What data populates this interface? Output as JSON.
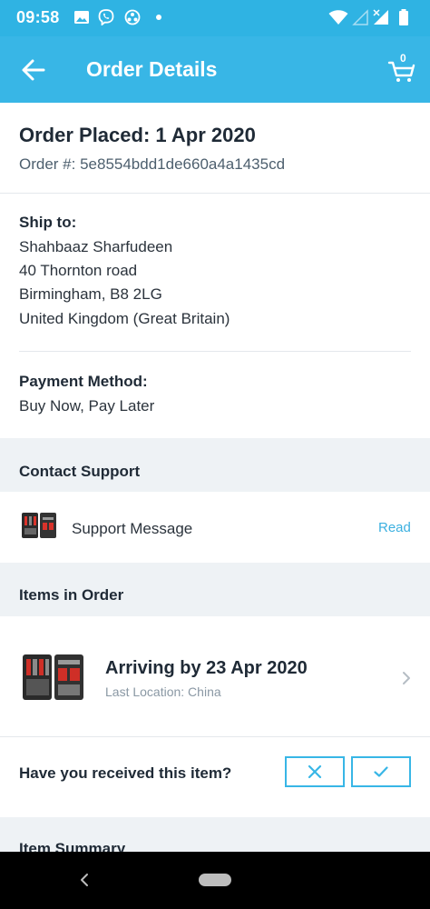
{
  "status_bar": {
    "time": "09:58",
    "icons": [
      "image-icon",
      "viber-icon",
      "sync-icon",
      "dot-icon",
      "wifi-icon",
      "signal-icon",
      "battery-icon"
    ]
  },
  "app_bar": {
    "title": "Order Details",
    "cart_count": "0",
    "color": "#38b6e6"
  },
  "order": {
    "placed": "Order Placed: 1 Apr 2020",
    "number": "Order #: 5e8554bdd1de660a4a1435cd"
  },
  "shipping": {
    "heading": "Ship to:",
    "name": "Shahbaaz Sharfudeen",
    "address_line1": "40 Thornton road",
    "address_line2": "Birmingham, B8 2LG",
    "country": "United Kingdom (Great Britain)"
  },
  "payment": {
    "heading": "Payment Method:",
    "method": "Buy Now, Pay Later"
  },
  "support": {
    "heading": "Contact Support",
    "message_label": "Support Message",
    "read_label": "Read"
  },
  "items": {
    "heading": "Items in Order",
    "arrival": "Arriving by 23 Apr 2020",
    "location": "Last Location: China"
  },
  "received": {
    "question": "Have you received this item?"
  },
  "summary": {
    "heading": "Item Summary"
  },
  "colors": {
    "accent": "#38b6e6",
    "link": "#3cb0e0",
    "section_band": "#eef2f5"
  }
}
